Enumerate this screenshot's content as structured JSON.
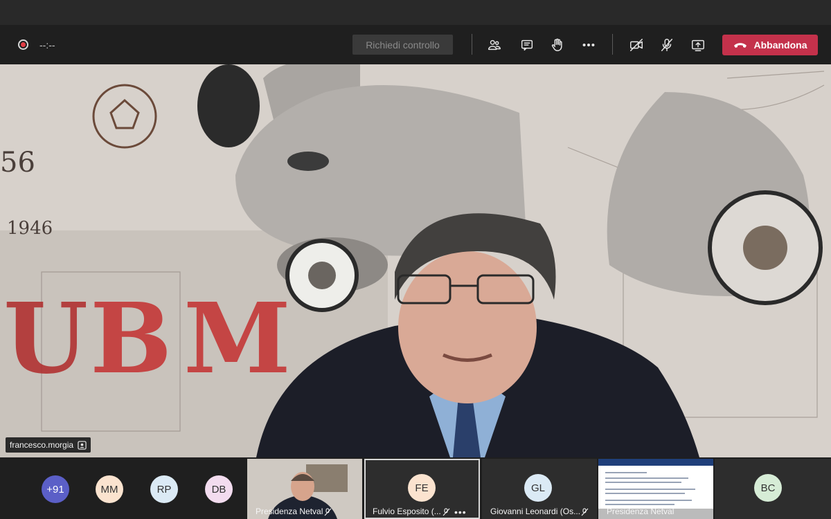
{
  "toolbar": {
    "timer": "--:--",
    "request_control_label": "Richiedi controllo",
    "leave_label": "Abbandona",
    "icons": [
      "participants-icon",
      "chat-icon",
      "raise-hand-icon",
      "more-icon",
      "camera-off-icon",
      "mic-off-icon",
      "share-screen-icon"
    ]
  },
  "main_video": {
    "participant_name": "francesco.morgia"
  },
  "participants_strip": {
    "overflow_count": "+91",
    "avatars": [
      {
        "initials": "MM",
        "color": "#fbe3cf"
      },
      {
        "initials": "RP",
        "color": "#dbeaf5"
      },
      {
        "initials": "DB",
        "color": "#f3dcef"
      }
    ],
    "tiles": [
      {
        "name": "Presidenza Netval"
      },
      {
        "name": "Fulvio Esposito (...",
        "initials": "FE",
        "color": "#fbe3cf"
      },
      {
        "name": "Giovanni Leonardi (Os...",
        "initials": "GL",
        "color": "#dbeaf5"
      },
      {
        "name": "Presidenza Netval"
      },
      {
        "initials": "BC",
        "color": "#d6ecd6"
      }
    ]
  }
}
